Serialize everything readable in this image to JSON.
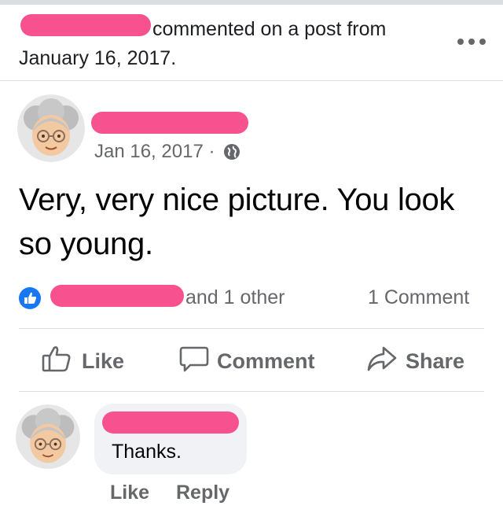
{
  "header": {
    "activity_text": "commented on a post from",
    "date": "January 16, 2017.",
    "more_icon": "more-horizontal-icon"
  },
  "post": {
    "timestamp": "Jan 16, 2017 ·",
    "privacy_icon": "globe-icon",
    "text": "Very, very nice picture. You look so young."
  },
  "reactions": {
    "summary_suffix": "and 1 other",
    "comment_count": "1 Comment",
    "badge_icon": "thumbs-up-icon",
    "badge_color": "#1877f2"
  },
  "actions": [
    {
      "label": "Like",
      "icon": "thumbs-up-outline-icon"
    },
    {
      "label": "Comment",
      "icon": "comment-bubble-icon"
    },
    {
      "label": "Share",
      "icon": "share-arrow-icon"
    }
  ],
  "comment": {
    "text": "Thanks.",
    "like_label": "Like",
    "reply_label": "Reply"
  },
  "colors": {
    "redaction": "#f7518f",
    "secondary_text": "#65676b",
    "divider": "#dadde1",
    "bubble": "#f0f2f5"
  }
}
